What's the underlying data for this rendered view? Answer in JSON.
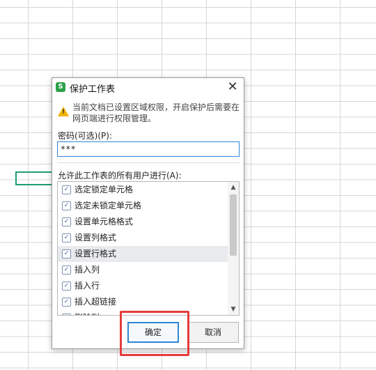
{
  "dialog": {
    "app_icon_letter": "S",
    "title": "保护工作表",
    "close_symbol": "✕",
    "warning": "当前文档已设置区域权限，开启保护后需要在网页端进行权限管理。",
    "password_label": "密码(可选)(P):",
    "password_value": "***",
    "permissions_label": "允许此工作表的所有用户进行(A):",
    "permissions": [
      {
        "label": "选定锁定单元格",
        "checked": true
      },
      {
        "label": "选定未锁定单元格",
        "checked": true
      },
      {
        "label": "设置单元格格式",
        "checked": true
      },
      {
        "label": "设置列格式",
        "checked": true
      },
      {
        "label": "设置行格式",
        "checked": true,
        "highlighted": true
      },
      {
        "label": "插入列",
        "checked": true
      },
      {
        "label": "插入行",
        "checked": true
      },
      {
        "label": "插入超链接",
        "checked": true
      },
      {
        "label": "删除列",
        "checked": true
      }
    ],
    "ok_label": "确定",
    "cancel_label": "取消"
  },
  "colors": {
    "accent": "#2f86d6",
    "selected_cell": "#1f9e72",
    "app_icon": "#2aa147",
    "warning": "#f2b400",
    "annotation": "#e53c3c"
  },
  "icons": {
    "app": "wps-spreadsheet-icon",
    "warning": "warning-triangle-icon",
    "close": "close-icon",
    "checkbox": "checkmark-icon",
    "scroll_up": "chevron-up-icon",
    "scroll_down": "chevron-down-icon"
  }
}
